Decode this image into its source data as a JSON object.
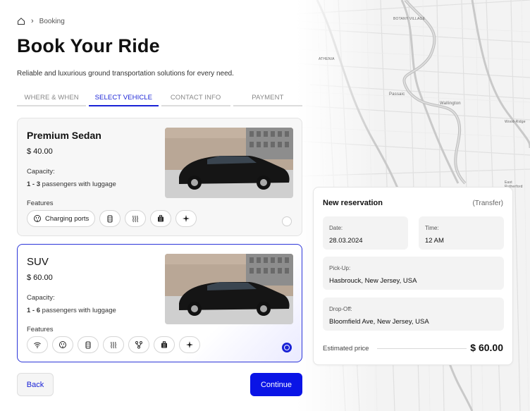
{
  "breadcrumb": {
    "home_icon": "home-icon",
    "separator": "›",
    "current": "Booking"
  },
  "page": {
    "title": "Book Your Ride",
    "subtitle": "Reliable and luxurious ground transportation solutions for every need."
  },
  "tabs": [
    {
      "label": "WHERE & WHEN",
      "active": false
    },
    {
      "label": "SELECT VEHICLE",
      "active": true
    },
    {
      "label": "CONTACT INFO",
      "active": false
    },
    {
      "label": "PAYMENT",
      "active": false
    }
  ],
  "vehicles": [
    {
      "name": "Premium Sedan",
      "price": "$ 40.00",
      "capacity_label": "Capacity:",
      "capacity_range": "1 - 3",
      "capacity_text": "passengers with luggage",
      "features_label": "Features",
      "features": [
        {
          "icon": "plug-icon",
          "label": "Charging ports"
        },
        {
          "icon": "water-bottle-icon"
        },
        {
          "icon": "heating-icon"
        },
        {
          "icon": "luggage-icon"
        },
        {
          "icon": "sparkle-icon"
        }
      ],
      "selected": false
    },
    {
      "name": "SUV",
      "price": "$ 60.00",
      "capacity_label": "Capacity:",
      "capacity_range": "1 - 6",
      "capacity_text": "passengers with luggage",
      "features_label": "Features",
      "features": [
        {
          "icon": "wifi-icon"
        },
        {
          "icon": "plug-icon"
        },
        {
          "icon": "water-bottle-icon"
        },
        {
          "icon": "heating-icon"
        },
        {
          "icon": "route-icon"
        },
        {
          "icon": "luggage-icon"
        },
        {
          "icon": "sparkle-icon"
        }
      ],
      "selected": true
    }
  ],
  "buttons": {
    "back": "Back",
    "continue": "Continue"
  },
  "reservation": {
    "title": "New reservation",
    "type": "(Transfer)",
    "date_label": "Date:",
    "date_value": "28.03.2024",
    "time_label": "Time:",
    "time_value": "12 AM",
    "pickup_label": "Pick-Up:",
    "pickup_value": "Hasbrouck, New Jersey, USA",
    "dropoff_label": "Drop-Off:",
    "dropoff_value": "Bloomfield Ave, New Jersey, USA",
    "estimate_label": "Estimated price",
    "estimate_value": "$ 60.00"
  },
  "map": {
    "labels": [
      "BOTANY VILLAGE",
      "ATHENIA",
      "Passaic",
      "Wallington",
      "Wood-Ridge",
      "East Rutherford"
    ]
  },
  "colors": {
    "accent": "#1a23d6",
    "continue_bg": "#0a14e6",
    "card_selected_border": "#2c35d8"
  }
}
